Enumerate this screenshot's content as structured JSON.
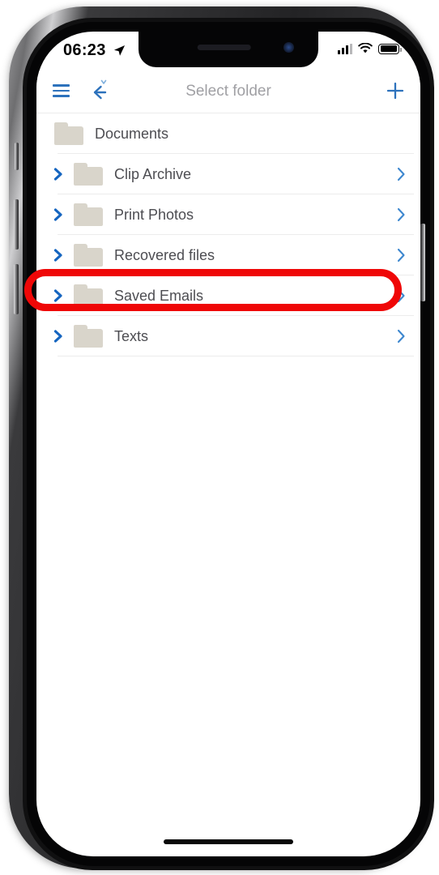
{
  "device": {
    "type": "smartphone-mockup",
    "frame_color": "#2a2a2c",
    "screen_background": "#ffffff"
  },
  "status_bar": {
    "time": "06:23",
    "location_icon": "location-arrow-icon",
    "signal_icon": "cellular-signal-icon",
    "signal_bars_filled": 3,
    "signal_bars_total": 4,
    "wifi_icon": "wifi-icon",
    "battery_icon": "battery-full-icon",
    "battery_level_percent": 100
  },
  "app_bar": {
    "menu_icon": "hamburger-menu-icon",
    "back_icon": "back-arrow-icon",
    "title": "Select folder",
    "add_icon": "plus-icon",
    "title_color": "#a0a0a4",
    "accent_color": "#2d72bc"
  },
  "folder_list": {
    "breadcrumb": {
      "label": "Documents",
      "icon": "folder-icon",
      "expandable": false
    },
    "items": [
      {
        "label": "Clip Archive",
        "icon": "folder-icon",
        "expand_icon": "chevron-right-expand-icon",
        "open_icon": "chevron-right-icon",
        "highlighted": false
      },
      {
        "label": "Print Photos",
        "icon": "folder-icon",
        "expand_icon": "chevron-right-expand-icon",
        "open_icon": "chevron-right-icon",
        "highlighted": false
      },
      {
        "label": "Recovered files",
        "icon": "folder-icon",
        "expand_icon": "chevron-right-expand-icon",
        "open_icon": "chevron-right-icon",
        "highlighted": false
      },
      {
        "label": "Saved Emails",
        "icon": "folder-icon",
        "expand_icon": "chevron-right-expand-icon",
        "open_icon": "chevron-right-icon",
        "highlighted": true
      },
      {
        "label": "Texts",
        "icon": "folder-icon",
        "expand_icon": "chevron-right-expand-icon",
        "open_icon": "chevron-right-icon",
        "highlighted": false
      }
    ],
    "folder_icon_color": "#d9d5cb",
    "label_color": "#4d4d52",
    "separator_color": "#ececec"
  },
  "annotation": {
    "shape": "oval-outline",
    "color": "#ef0707",
    "stroke_width_px": 9,
    "targets_label": "Saved Emails"
  },
  "home_indicator": {
    "visible": true,
    "color": "#080808"
  }
}
